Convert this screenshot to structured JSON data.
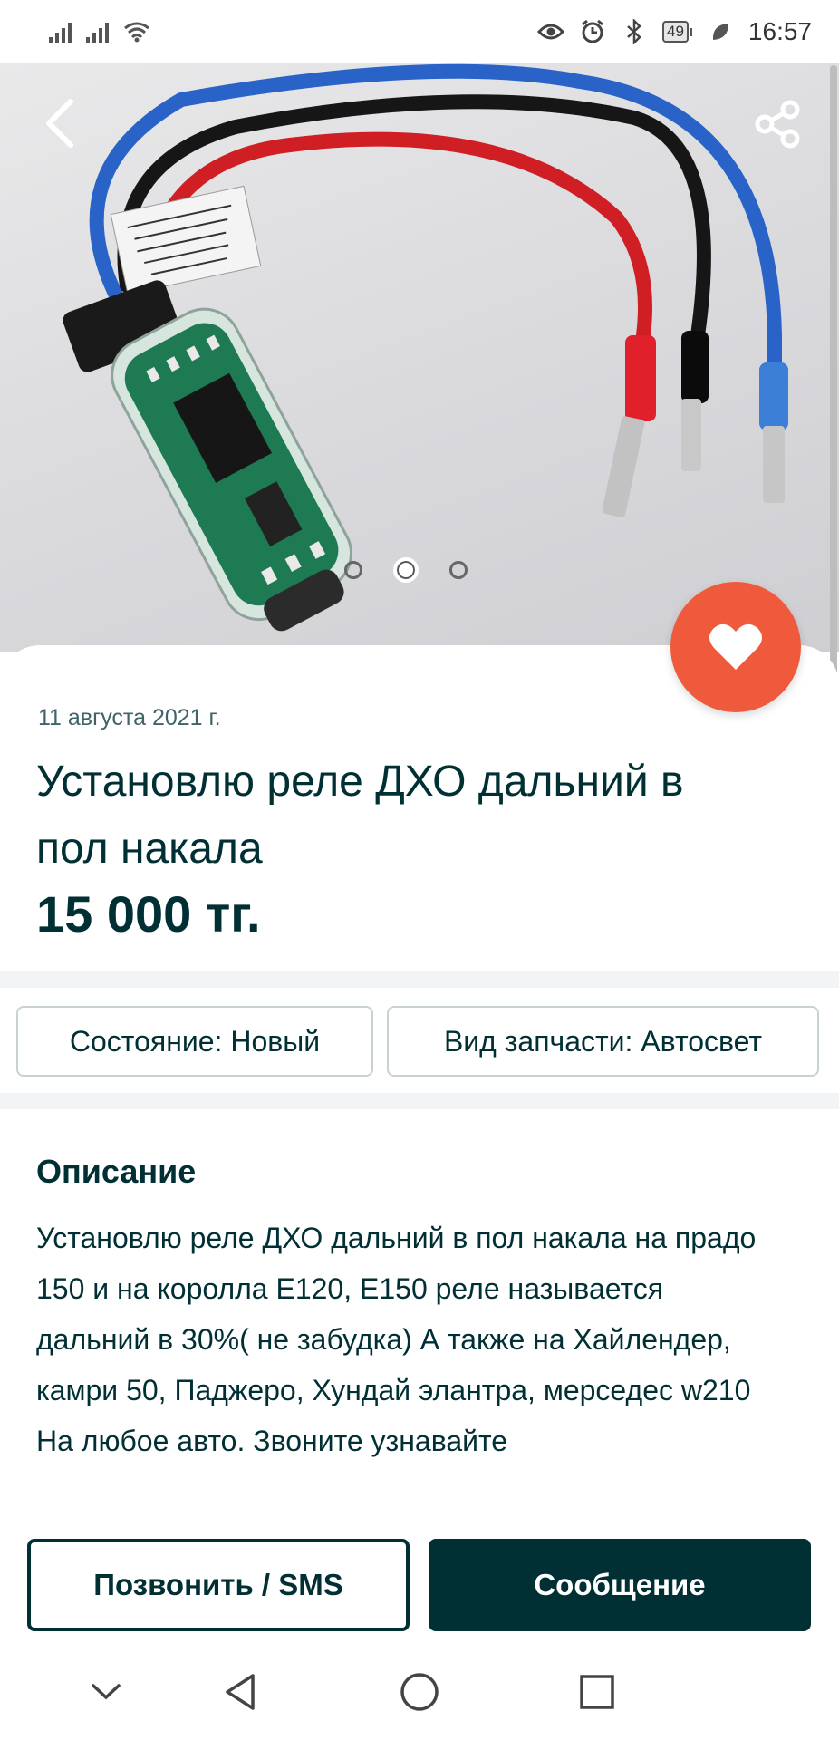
{
  "status_bar": {
    "time": "16:57",
    "battery": "49",
    "icons": [
      "signal-icon",
      "signal-icon",
      "wifi-icon",
      "eye-icon",
      "alarm-icon",
      "bluetooth-icon",
      "battery-icon",
      "leaf-icon"
    ]
  },
  "gallery": {
    "image_count": 3,
    "active_index": 1,
    "icons": {
      "back": "chevron-left-icon",
      "share": "share-icon",
      "favorite": "heart-icon"
    }
  },
  "listing": {
    "date": "11 августа 2021 г.",
    "title": "Установлю реле ДХО дальний в пол накала",
    "price": "15 000 тг."
  },
  "params": [
    {
      "label": "Состояние: Новый"
    },
    {
      "label": "Вид запчасти: Автосвет"
    }
  ],
  "description": {
    "heading": "Описание",
    "text": "Установлю реле ДХО дальний в пол накала на прадо 150 и на королла Е120, Е150 реле называется дальний в 30%( не забудка) А также на Хайлендер, камри 50, Паджеро, Хундай элантра, мерседес w210 На любое авто. Звоните узнавайте"
  },
  "actions": {
    "call_label": "Позвонить / SMS",
    "message_label": "Сообщение"
  },
  "colors": {
    "brand_dark": "#002f34",
    "favorite_accent": "#f05a3c",
    "divider": "#f2f4f5"
  },
  "nav_bar": {
    "icons": [
      "chevron-down-icon",
      "back-triangle-icon",
      "home-circle-icon",
      "recents-square-icon"
    ]
  }
}
